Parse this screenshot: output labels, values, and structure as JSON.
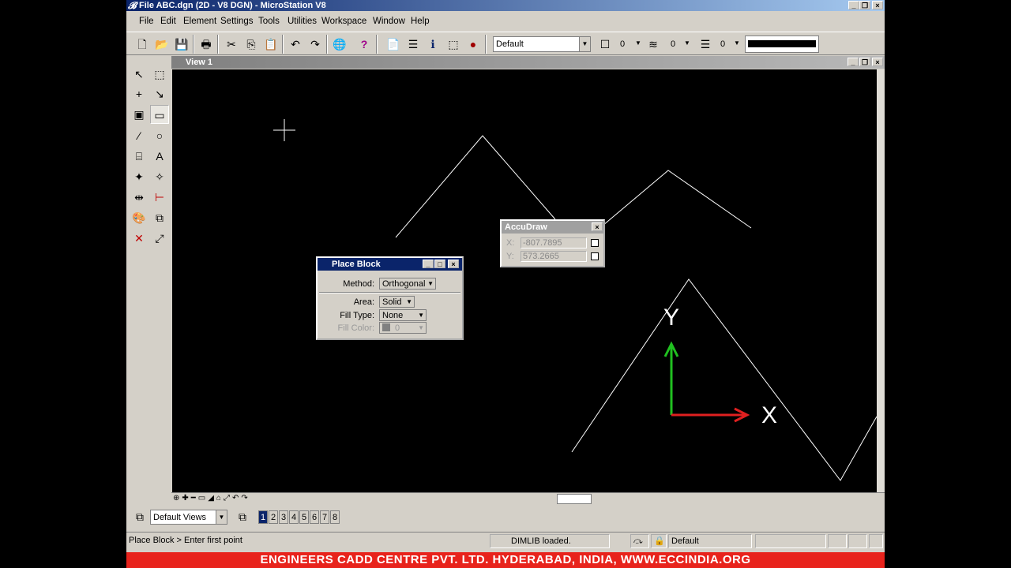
{
  "window": {
    "title": "File ABC.dgn (2D - V8 DGN) - MicroStation V8"
  },
  "menu": [
    "File",
    "Edit",
    "Element",
    "Settings",
    "Tools",
    "Utilities",
    "Workspace",
    "Window",
    "Help"
  ],
  "toolbar": {
    "level": "Default",
    "color": "0",
    "style": "0",
    "weight": "0"
  },
  "view": {
    "title": "View 1"
  },
  "axis": {
    "x_label": "X",
    "y_label": "Y"
  },
  "place_block": {
    "title": "Place Block",
    "method_label": "Method:",
    "method_value": "Orthogonal",
    "area_label": "Area:",
    "area_value": "Solid",
    "fill_type_label": "Fill Type:",
    "fill_type_value": "None",
    "fill_color_label": "Fill Color:",
    "fill_color_value": "0"
  },
  "accudraw": {
    "title": "AccuDraw",
    "x_label": "X:",
    "x_value": "-807.7895",
    "y_label": "Y:",
    "y_value": "573.2665"
  },
  "viewbar": {
    "views_combo": "Default Views",
    "view_numbers": [
      "1",
      "2",
      "3",
      "4",
      "5",
      "6",
      "7",
      "8"
    ]
  },
  "status": {
    "prompt": "Place Block > Enter first point",
    "message": "DIMLIB loaded.",
    "level": "Default"
  },
  "banner": "ENGINEERS CADD CENTRE PVT. LTD. HYDERABAD, INDIA, WWW.ECCINDIA.ORG",
  "colors": {
    "titlebar": "#0a246a",
    "banner": "#e8231c",
    "axis_x": "#e02020",
    "axis_y": "#20c020"
  }
}
